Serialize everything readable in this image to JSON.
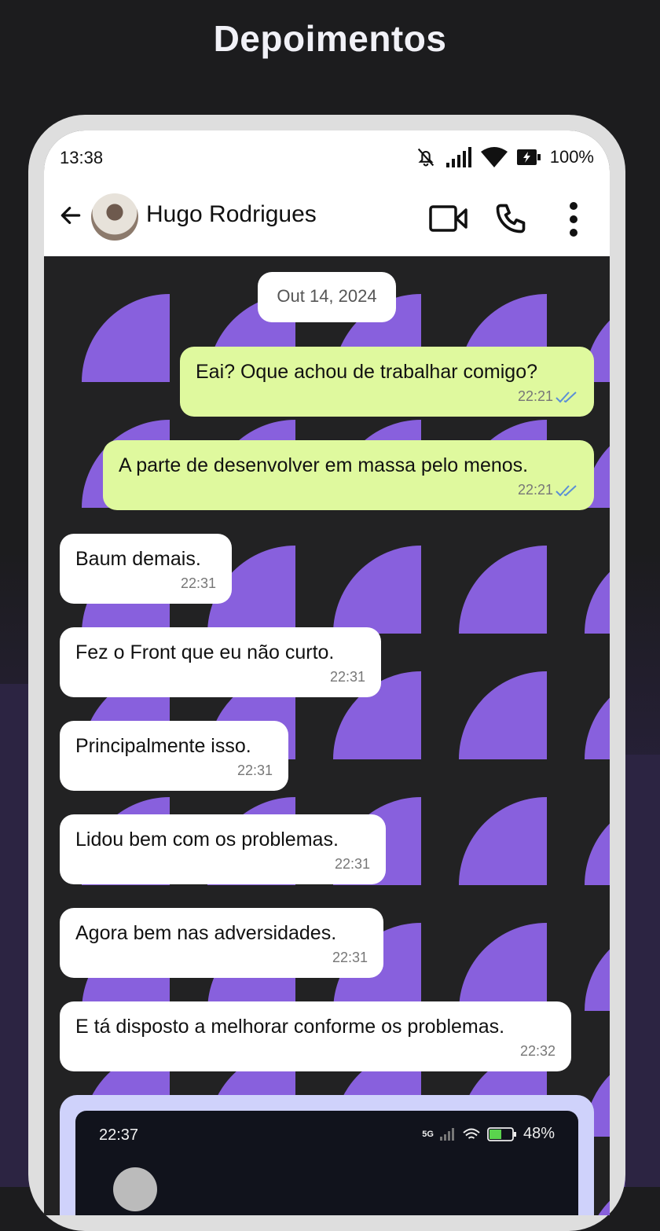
{
  "page": {
    "title": "Depoimentos"
  },
  "phone": {
    "status": {
      "time": "13:38",
      "battery": "100%"
    },
    "header": {
      "contact_name": "Hugo Rodrigues"
    },
    "chat": {
      "date": "Out 14, 2024",
      "messages": [
        {
          "direction": "out",
          "text": "Eai? Oque achou de trabalhar comigo?",
          "time": "22:21",
          "read": true
        },
        {
          "direction": "out",
          "text": "A parte de desenvolver em massa pelo menos.",
          "time": "22:21",
          "read": true
        },
        {
          "direction": "in",
          "text": "Baum demais.",
          "time": "22:31"
        },
        {
          "direction": "in",
          "text": "Fez o Front que eu não curto.",
          "time": "22:31"
        },
        {
          "direction": "in",
          "text": "Principalmente isso.",
          "time": "22:31"
        },
        {
          "direction": "in",
          "text": "Lidou bem com os problemas.",
          "time": "22:31"
        },
        {
          "direction": "in",
          "text": "Agora bem nas adversidades.",
          "time": "22:31"
        },
        {
          "direction": "in",
          "text": "E tá disposto a melhorar conforme os problemas.",
          "time": "22:32"
        }
      ],
      "embedded_screenshot": {
        "time": "22:37",
        "battery": "48%",
        "network": "5G"
      }
    }
  },
  "colors": {
    "background": "#1c1c1e",
    "pattern": "#8860dd",
    "outgoing_bubble": "#dff99e",
    "incoming_bubble": "#ffffff",
    "read_ticks": "#5b8fd6"
  },
  "icons": [
    "back-arrow-icon",
    "video-call-icon",
    "phone-icon",
    "more-vert-icon",
    "bell-off-icon",
    "signal-icon",
    "wifi-icon",
    "battery-charging-icon",
    "double-check-icon"
  ]
}
